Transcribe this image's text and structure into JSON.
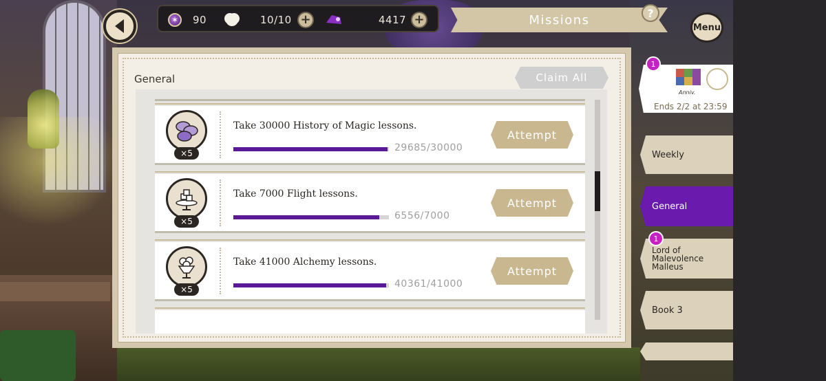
{
  "header": {
    "currency_gem": "90",
    "stamina": "10/10",
    "madol": "4417",
    "title": "Missions",
    "help_symbol": "?",
    "menu_label": "Menu"
  },
  "panel": {
    "section_title": "General",
    "claim_all_label": "Claim All",
    "missions": [
      {
        "text": "Take 30000 History of Magic lessons.",
        "reward_count": "×5",
        "progress_label": "29685/30000",
        "progress": 0.9895,
        "button": "Attempt",
        "reward_icon": "macaron-icon"
      },
      {
        "text": "Take 7000 Flight lessons.",
        "reward_count": "×5",
        "progress_label": "6556/7000",
        "progress": 0.9366,
        "button": "Attempt",
        "reward_icon": "sugar-cubes-icon"
      },
      {
        "text": "Take 41000 Alchemy lessons.",
        "reward_count": "×5",
        "progress_label": "40361/41000",
        "progress": 0.9844,
        "button": "Attempt",
        "reward_icon": "parfait-icon"
      }
    ]
  },
  "side": {
    "event_badge": "1",
    "event_logo_text": "Anniv.",
    "event_ends": "Ends 2/2 at 23:59",
    "tabs": [
      {
        "label": "Weekly"
      },
      {
        "label": "General"
      },
      {
        "label_lines": [
          "Lord of",
          "Malevolence",
          "Malleus"
        ],
        "badge": "1"
      },
      {
        "label": "Book 3"
      }
    ]
  },
  "colors": {
    "accent_purple": "#6a1bae",
    "progress": "#5a1996",
    "button_tan": "#c9b78f",
    "badge_magenta": "#c422c4"
  }
}
